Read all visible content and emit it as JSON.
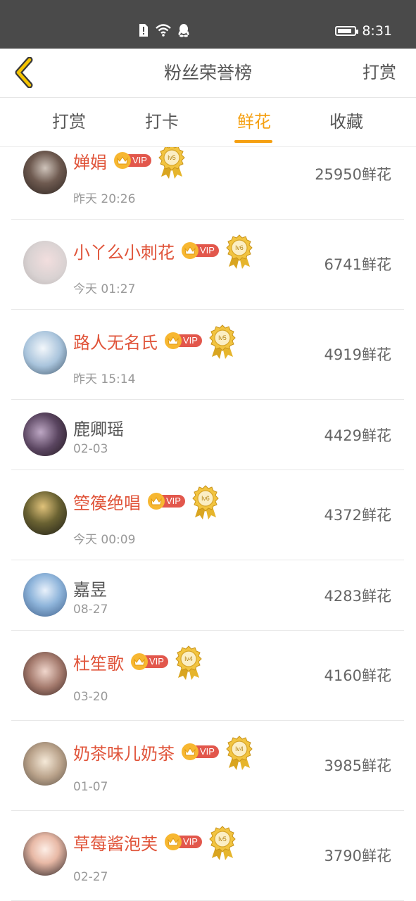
{
  "status_bar": {
    "time": "8:31",
    "battery_level": 0.85,
    "icons": [
      "alert-sim-icon",
      "wifi-icon",
      "qq-penguin-icon"
    ]
  },
  "nav": {
    "title": "粉丝荣誉榜",
    "action_label": "打赏",
    "back_icon": "chevron-left-icon"
  },
  "colors": {
    "accent": "#f5a012",
    "vip_name": "#e0543a",
    "status_bar": "#4a4a4a"
  },
  "tabs": [
    {
      "label": "打赏",
      "active": false
    },
    {
      "label": "打卡",
      "active": false
    },
    {
      "label": "鲜花",
      "active": true
    },
    {
      "label": "收藏",
      "active": false
    }
  ],
  "fans": [
    {
      "name": "婵娟",
      "vip": true,
      "level": "lv5",
      "time": "昨天 20:26",
      "count": "25950鲜花"
    },
    {
      "name": "小丫么小刺花",
      "vip": true,
      "level": "lv6",
      "time": "今天 01:27",
      "count": "6741鲜花"
    },
    {
      "name": "路人无名氏",
      "vip": true,
      "level": "lv5",
      "time": "昨天 15:14",
      "count": "4919鲜花"
    },
    {
      "name": "鹿卿瑶",
      "vip": false,
      "level": "",
      "time": "02-03",
      "count": "4429鲜花"
    },
    {
      "name": "箜篌绝唱",
      "vip": true,
      "level": "lv6",
      "time": "今天 00:09",
      "count": "4372鲜花"
    },
    {
      "name": "嘉昱",
      "vip": false,
      "level": "",
      "time": "08-27",
      "count": "4283鲜花"
    },
    {
      "name": "杜笙歌",
      "vip": true,
      "level": "lv4",
      "time": "03-20",
      "count": "4160鲜花"
    },
    {
      "name": "奶茶味儿奶茶",
      "vip": true,
      "level": "lv4",
      "time": "01-07",
      "count": "3985鲜花"
    },
    {
      "name": "草莓酱泡芙",
      "vip": true,
      "level": "lv5",
      "time": "02-27",
      "count": "3790鲜花"
    }
  ],
  "vip_label": "VIP"
}
